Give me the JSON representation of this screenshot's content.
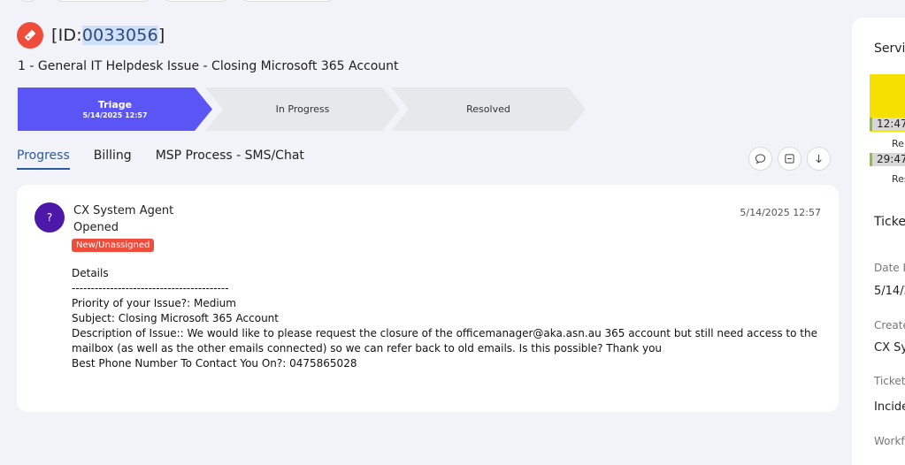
{
  "header": {
    "id_prefix": "[ID:",
    "id_number": "0033056",
    "id_suffix": "]",
    "title": "1 - General IT Helpdesk Issue - Closing Microsoft 365 Account"
  },
  "pipeline": {
    "stages": [
      {
        "label": "Triage",
        "date": "5/14/2025 12:57"
      },
      {
        "label": "In Progress"
      },
      {
        "label": "Resolved"
      }
    ]
  },
  "tabs": [
    {
      "label": "Progress"
    },
    {
      "label": "Billing"
    },
    {
      "label": "MSP Process - SMS/Chat"
    }
  ],
  "icons": {
    "ticket": "ticket-icon",
    "comment": "comment-icon",
    "collapse": "collapse-icon",
    "download": "arrow-down-icon"
  },
  "activity": {
    "avatar_letter": "?",
    "agent": "CX System Agent",
    "event": "Opened",
    "status_badge": "New/Unassigned",
    "timestamp": "5/14/2025 12:57",
    "details": {
      "heading": "Details",
      "divider": "-----------------------------------------",
      "priority": "Priority of your Issue?: Medium",
      "subject": "Subject: Closing Microsoft 365 Account",
      "description": "Description of Issue:: We would like to please request the closure of the officemanager@aka.asn.au 365 account but still need access to the mailbox (as well as the other emails connected) so we can refer back to old emails. Is this possible? Thank you",
      "phone": "Best Phone Number To Contact You On?: 0475865028"
    }
  },
  "side_panel": {
    "service_heading": "Servi",
    "timer1": "12:47",
    "timer1_label": "Re",
    "timer2": "29:47",
    "timer2_label": "Res",
    "ticket_heading": "Ticke",
    "fields": [
      {
        "label": "Date F",
        "value": "5/14/2"
      },
      {
        "label": "Create",
        "value": "CX Sys"
      },
      {
        "label": "Ticket",
        "value": "Incide"
      },
      {
        "label": "Workf",
        "value": ""
      }
    ]
  },
  "colors": {
    "accent": "#5b55f5",
    "ticket_icon": "#ef4d3c",
    "badge": "#ef4d3c",
    "avatar": "#4b18a8",
    "active_tab": "#2c5aa0",
    "sla_yellow": "#f5e000"
  }
}
